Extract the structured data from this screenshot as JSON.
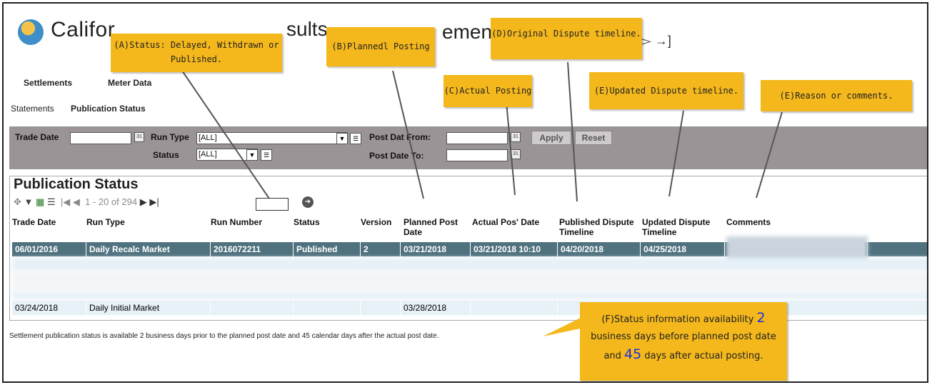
{
  "header": {
    "logo_text": "Califor",
    "frag_sults": "sults",
    "frag_emen": "emen",
    "icons": "▻ →]"
  },
  "nav": {
    "settlements": "Settlements",
    "meter_data": "Meter Data",
    "statements": "Statements",
    "publication_status": "Publication Status"
  },
  "filter": {
    "trade_date_label": "Trade Date",
    "run_type_label": "Run Type",
    "run_type_value": "[ALL]",
    "status_label": "Status",
    "status_value": "[ALL]",
    "post_date_from_label": "Post Dat From:",
    "post_date_to_label": "Post Date To:",
    "apply": "Apply",
    "reset": "Reset"
  },
  "panel": {
    "title": "Publication Status",
    "pager_text": "1 - 20 of 294"
  },
  "table": {
    "headers": [
      "Trade Date",
      "Run Type",
      "Run Number",
      "Status",
      "Version",
      "Planned Post Date",
      "Actual Pos' Date",
      "Published Dispute Timeline",
      "Updated Dispute Timeline",
      "Comments"
    ],
    "selected_row": [
      "06/01/2016",
      "Daily Recalc Market",
      "2016072211",
      "Published",
      "2",
      "03/21/2018",
      "03/21/2018 10:10",
      "04/20/2018",
      "04/25/2018",
      ""
    ],
    "last_row": [
      "03/24/2018",
      "Daily Initial Market",
      "",
      "",
      "",
      "03/28/2018",
      "",
      "",
      "",
      ""
    ]
  },
  "note": "Settlement publication status is available 2 business days prior to the planned post date and 45 calendar days after the actual post date.",
  "callouts": {
    "a": "(A)Status: Delayed, Withdrawn or Published.",
    "b": "(B)Plannedl Posting",
    "c": "(C)Actual Posting",
    "d": "(D)Original Dispute timeline.",
    "e1": "(E)Updated Dispute timeline.",
    "e2": "(E)Reason or comments.",
    "f_line1": "(F)Status information availability",
    "f_num1": "2",
    "f_line2": "business days before planned post date",
    "f_and": "and",
    "f_num2": "45",
    "f_line3": "days after actual posting."
  },
  "colors": {
    "callout": "#f4b81c",
    "filter_bar": "#9b9496",
    "selected_row": "#50727f",
    "alt_row": "#e6f1f8"
  }
}
